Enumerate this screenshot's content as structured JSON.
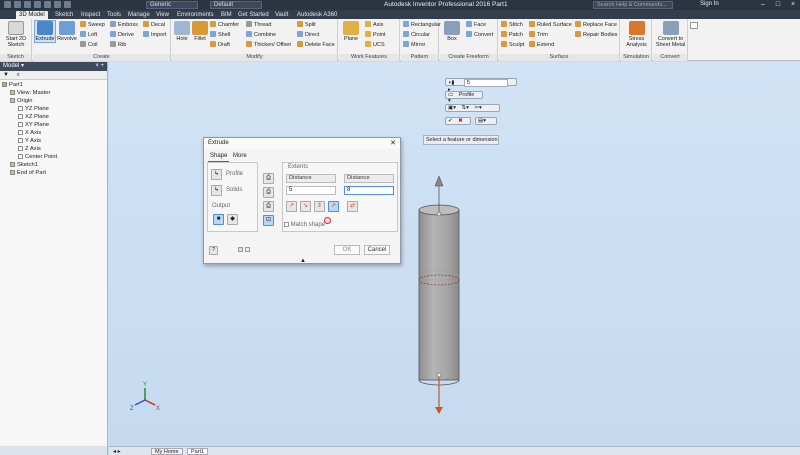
{
  "titlebar": {
    "style_combo": "Generic",
    "appearance_combo": "Default",
    "app_title": "Autodesk Inventor Professional 2016    Part1",
    "search_placeholder": "Search Help & Commands...",
    "sign_in": "Sign In"
  },
  "tabs": [
    "3D Model",
    "Sketch",
    "Inspect",
    "Tools",
    "Manage",
    "View",
    "Environments",
    "BIM",
    "Get Started",
    "Vault",
    "Autodesk A360"
  ],
  "active_tab": "3D Model",
  "ribbon": {
    "sketch_group": {
      "label": "Sketch",
      "start_sketch": "Start 2D Sketch"
    },
    "create_group": {
      "label": "Create",
      "extrude": "Extrude",
      "revolve": "Revolve",
      "sweep": "Sweep",
      "loft": "Loft",
      "coil": "Coil",
      "emboss": "Emboss",
      "derive": "Derive",
      "rib": "Rib",
      "decal": "Decal",
      "import": "Import"
    },
    "modify_group": {
      "label": "Modify",
      "hole": "Hole",
      "fillet": "Fillet",
      "chamfer": "Chamfer",
      "shell": "Shell",
      "draft": "Draft",
      "thread": "Thread",
      "combine": "Combine",
      "thicken": "Thicken/ Offset",
      "split": "Split",
      "direct": "Direct",
      "delete_face": "Delete Face"
    },
    "work_group": {
      "label": "Work Features",
      "plane": "Plane",
      "axis": "Axis",
      "point": "Point",
      "ucs": "UCS"
    },
    "pattern_group": {
      "label": "Pattern",
      "rectangular": "Rectangular",
      "circular": "Circular",
      "mirror": "Mirror"
    },
    "freeform_group": {
      "label": "Create Freeform",
      "box": "Box",
      "face": "Face",
      "convert": "Convert"
    },
    "surface_group": {
      "label": "Surface",
      "stitch": "Stitch",
      "patch": "Patch",
      "sculpt": "Sculpt",
      "ruled": "Ruled Surface",
      "trim": "Trim",
      "extend": "Extend",
      "replace": "Replace Face",
      "repair": "Repair Bodies"
    },
    "sim_group": {
      "label": "Simulation",
      "stress": "Stress Analysis"
    },
    "convert_group": {
      "label": "Convert",
      "sheet": "Convert to Sheet Metal"
    }
  },
  "browser": {
    "title": "Model",
    "tree": [
      {
        "label": "Part1",
        "indent": 0
      },
      {
        "label": "View: Master",
        "indent": 1
      },
      {
        "label": "Origin",
        "indent": 1
      },
      {
        "label": "YZ Plane",
        "indent": 2
      },
      {
        "label": "XZ Plane",
        "indent": 2
      },
      {
        "label": "XY Plane",
        "indent": 2
      },
      {
        "label": "X Axis",
        "indent": 2
      },
      {
        "label": "Y Axis",
        "indent": 2
      },
      {
        "label": "Z Axis",
        "indent": 2
      },
      {
        "label": "Center Point",
        "indent": 2
      },
      {
        "label": "Sketch1",
        "indent": 1
      },
      {
        "label": "End of Part",
        "indent": 1
      }
    ]
  },
  "mini_toolbar": {
    "distance_value": "5",
    "profile_label": "Profile"
  },
  "tooltip": "Select a feature or dimension",
  "dialog": {
    "title": "Extrude",
    "tab_shape": "Shape",
    "tab_more": "More",
    "profile_label": "Profile",
    "solids_label": "Solids",
    "output_label": "Output",
    "extents_label": "Extents",
    "extent1_type": "Distance",
    "extent2_type": "Distance",
    "extent1_value": "5",
    "extent2_value": "8",
    "match_shape": "Match shape",
    "ok": "OK",
    "cancel": "Cancel"
  },
  "doc_tabs": [
    "My Home",
    "Part1"
  ],
  "colors": {
    "body_fill": "#a9a9a9",
    "accent": "#1a6fd0",
    "dim_arrow": "#c05a20"
  }
}
